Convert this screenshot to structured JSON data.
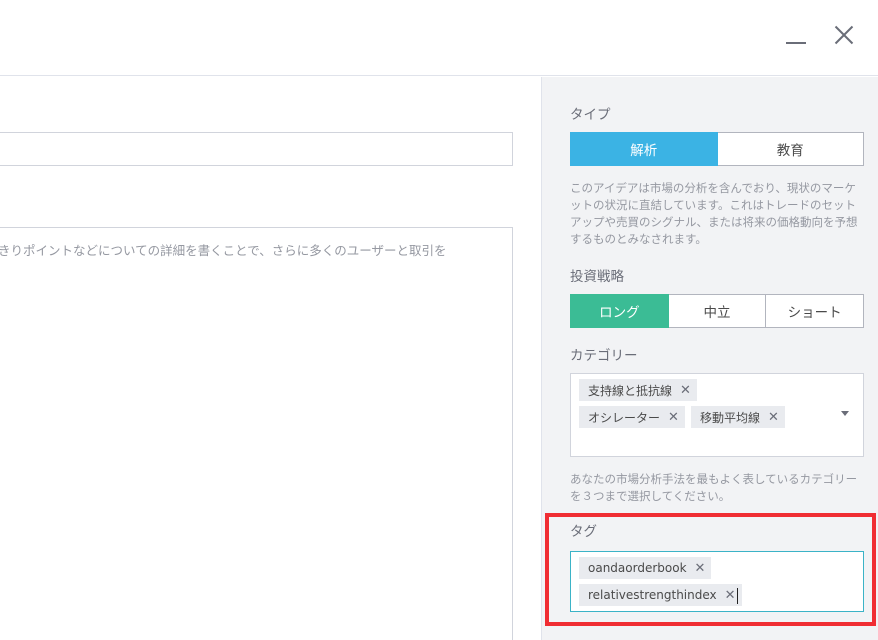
{
  "left": {
    "description_placeholder": "きりポイントなどについての詳細を書くことで、さらに多くのユーザーと取引を"
  },
  "type_section": {
    "label": "タイプ",
    "options": [
      "解析",
      "教育"
    ],
    "selected": "解析",
    "help": "このアイデアは市場の分析を含んでおり、現状のマーケットの状況に直結しています。これはトレードのセットアップや売買のシグナル、または将来の価格動向を予想するものとみなされます。"
  },
  "strategy_section": {
    "label": "投資戦略",
    "options": [
      "ロング",
      "中立",
      "ショート"
    ],
    "selected": "ロング"
  },
  "category_section": {
    "label": "カテゴリー",
    "chips": [
      "支持線と抵抗線",
      "オシレーター",
      "移動平均線"
    ],
    "remove_glyph": "✕",
    "help": "あなたの市場分析手法を最もよく表しているカテゴリーを３つまで選択してください。"
  },
  "tag_section": {
    "label": "タグ",
    "chips": [
      "oandaorderbook",
      "relativestrengthindex"
    ],
    "remove_glyph": "✕"
  },
  "colors": {
    "type_active": "#3bb3e4",
    "strategy_active": "#3bbc95",
    "highlight": "#f02d33"
  },
  "icons": {
    "minimize": "minimize-icon",
    "close": "close-icon",
    "dropdown": "chevron-down-icon"
  }
}
